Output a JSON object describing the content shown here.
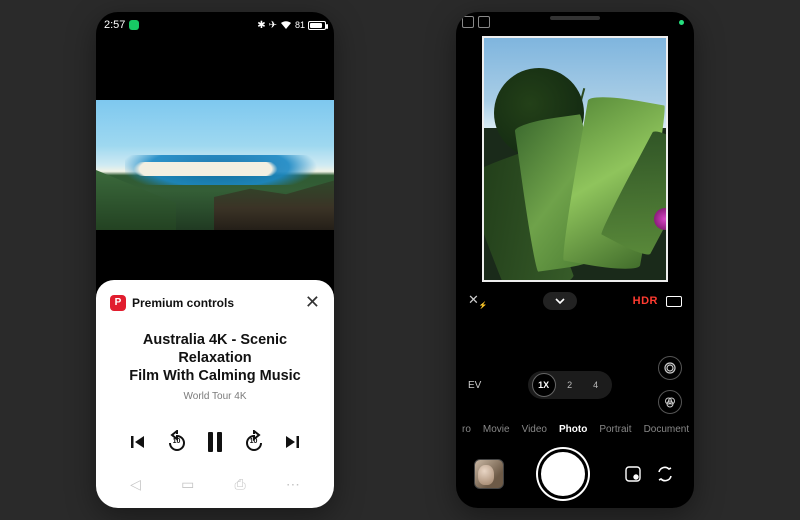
{
  "left": {
    "status": {
      "time": "2:57",
      "battery_pct": "81"
    },
    "sheet": {
      "badge_letter": "P",
      "header": "Premium controls",
      "video_title_line1": "Australia 4K - Scenic Relaxation",
      "video_title_line2": "Film With Calming Music",
      "channel": "World Tour 4K",
      "rewind_secs": "10",
      "forward_secs": "10"
    }
  },
  "right": {
    "hdr_label": "HDR",
    "ev_label": "EV",
    "zoom": {
      "opt1": "1X",
      "opt2": "2",
      "opt3": "4",
      "selected": "1X"
    },
    "modes": {
      "m0": "ro",
      "m1": "Movie",
      "m2": "Video",
      "m3": "Photo",
      "m4": "Portrait",
      "m5": "Document",
      "active": "Photo"
    }
  }
}
